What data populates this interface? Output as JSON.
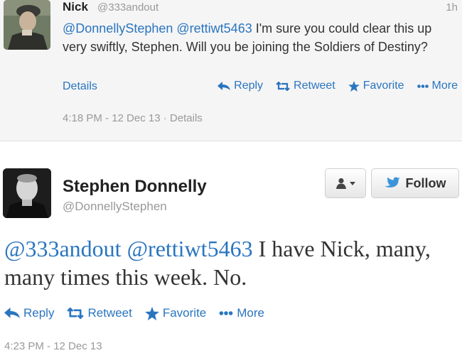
{
  "tweet1": {
    "name": "Nick",
    "handle": "@333andout",
    "time_ago": "1h",
    "mention1": "@DonnellyStephen",
    "mention2": "@rettiwt5463",
    "body": " I'm sure you could clear this up very swiftly, Stephen. Will you be joining the Soldiers of Destiny?",
    "details_label": "Details",
    "reply_label": "Reply",
    "retweet_label": "Retweet",
    "favorite_label": "Favorite",
    "more_label": "More",
    "timestamp": "4:18 PM - 12 Dec 13",
    "separator": " · ",
    "timestamp_details": "Details"
  },
  "tweet2": {
    "name": "Stephen Donnelly",
    "handle": "@DonnellyStephen",
    "follow_label": "Follow",
    "mention1": "@333andout",
    "mention2": "@rettiwt5463",
    "body": " I have Nick, many, many times this week. No.",
    "reply_label": "Reply",
    "retweet_label": "Retweet",
    "favorite_label": "Favorite",
    "more_label": "More",
    "timestamp": "4:23 PM - 12 Dec 13"
  },
  "icons": {
    "reply": "reply-arrow-icon",
    "retweet": "retweet-icon",
    "favorite": "star-icon",
    "more": "dots-icon",
    "bird": "twitter-bird-icon",
    "user": "user-icon"
  },
  "colors": {
    "link": "#2a75bf",
    "muted": "#999999",
    "text": "#333333",
    "top_bg": "#f5f5f5"
  }
}
